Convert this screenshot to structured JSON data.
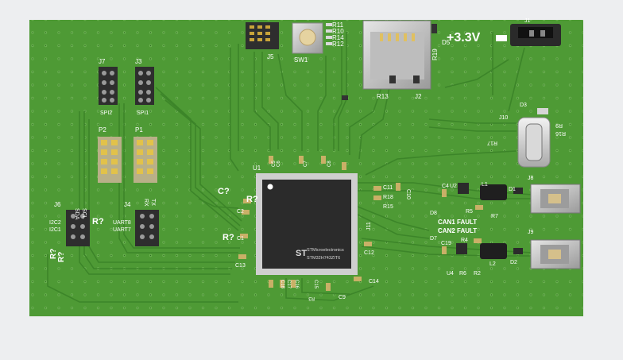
{
  "colors": {
    "background": "#edeef0",
    "board": "#4e9a35",
    "trace": "#3f8a2c",
    "silkscreen": "#ffffff",
    "chip": "#2b2b2b",
    "header_pin": "#d8b540"
  },
  "power": {
    "label": "+3.3V"
  },
  "labels": {
    "j1": "J1",
    "j2": "J2",
    "j5": "J5",
    "sw1": "SW1",
    "r11": "R11",
    "r10": "R10",
    "r14": "R14",
    "r12": "R12",
    "r19": "R19",
    "d5": "D5",
    "r13": "R13",
    "j7": "J7",
    "j3": "J3",
    "spi2": "SPI2",
    "spi1": "SPI1",
    "p2": "P2",
    "p1": "P1",
    "j6": "J6",
    "j4": "J4",
    "sda": "SDA",
    "scl": "SCL",
    "i2c2": "I2C2",
    "i2c1": "I2C1",
    "rx": "RX",
    "tx": "TX",
    "uart8": "UART8",
    "uart7": "UART7",
    "r_q1": "R?",
    "r_q2": "R?",
    "r_q3": "R?",
    "r_q4": "R?",
    "r_q5": "R?",
    "c_q": "C?",
    "u1": "U1",
    "c2": "C2",
    "c1": "C1",
    "c13": "C13",
    "c5": "C5",
    "c6": "C6",
    "c7": "C7",
    "c8": "C8",
    "c11": "C11",
    "r18": "R18",
    "r15": "R15",
    "c10": "C10",
    "j11": "J11",
    "c12": "C12",
    "c14": "C14",
    "c9": "C9",
    "c15": "C15",
    "c16": "C16",
    "c17": "C17",
    "c18": "C18",
    "r3": "R3",
    "d3": "D3",
    "j10": "J10",
    "r16": "R16",
    "r9": "R9",
    "r17": "R17",
    "r1": "R1",
    "j8": "J8",
    "j9": "J9",
    "u2": "U2",
    "c4": "C4",
    "l1": "L1",
    "d1": "D1",
    "r5": "R5",
    "r7": "R7",
    "d8": "D8",
    "d7": "D7",
    "can1_fault": "CAN1 FAULT",
    "can2_fault": "CAN2 FAULT",
    "c19": "C19",
    "r4": "R4",
    "u4": "U4",
    "r6": "R6",
    "r2": "R2",
    "l2": "L2",
    "d2": "D2",
    "mcu_brand": "STMicroelectronics",
    "mcu_part": "STM32H743ZIT6"
  }
}
